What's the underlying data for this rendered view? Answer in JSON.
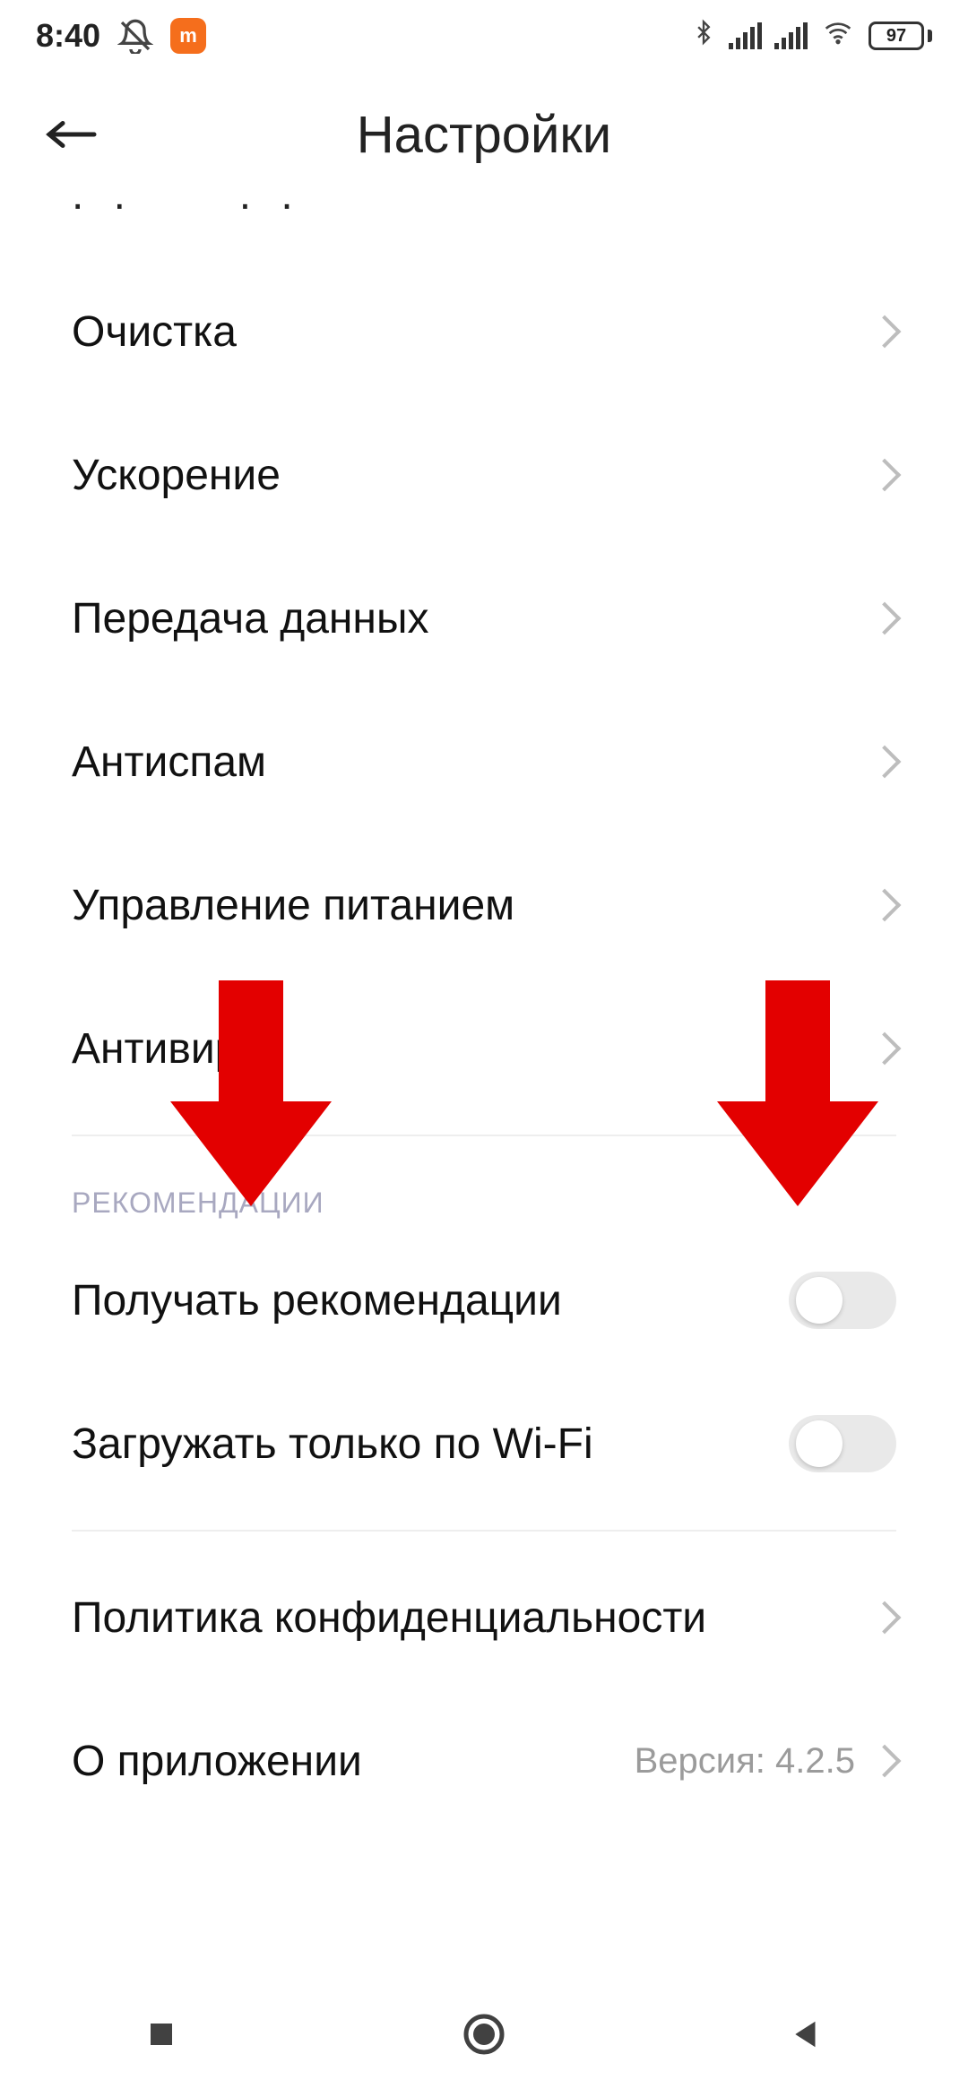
{
  "status": {
    "time": "8:40",
    "battery_pct": "97"
  },
  "header": {
    "title": "Настройки"
  },
  "rows": {
    "cleanup": "Очистка",
    "speedup": "Ускорение",
    "data_transfer": "Передача данных",
    "antispam": "Антиспам",
    "power_mgmt": "Управление питанием",
    "antivirus": "Антивирус"
  },
  "section_recommend": "РЕКОМЕНДАЦИИ",
  "toggles": {
    "receive_recs": "Получать рекомендации",
    "wifi_only": "Загружать только по Wi-Fi"
  },
  "privacy": "Политика конфиденциальности",
  "about": {
    "label": "О приложении",
    "version": "Версия: 4.2.5"
  }
}
